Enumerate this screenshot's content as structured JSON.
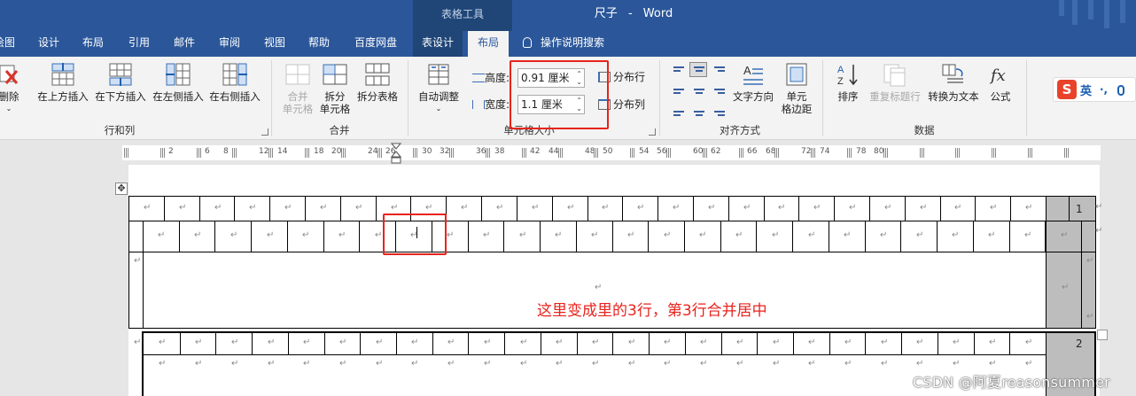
{
  "window": {
    "context_tab_group": "表格工具",
    "doc_name": "尺子",
    "separator": "-",
    "app_name": "Word"
  },
  "tabs": [
    {
      "label": "绘图"
    },
    {
      "label": "设计"
    },
    {
      "label": "布局"
    },
    {
      "label": "引用"
    },
    {
      "label": "邮件"
    },
    {
      "label": "审阅"
    },
    {
      "label": "视图"
    },
    {
      "label": "帮助"
    },
    {
      "label": "百度网盘"
    },
    {
      "label": "表设计"
    },
    {
      "label": "布局",
      "active": true
    }
  ],
  "search": {
    "label": "操作说明搜索"
  },
  "ribbon": {
    "delete": {
      "label": "删除"
    },
    "insert_above": {
      "label": "在上方插入"
    },
    "insert_below": {
      "label": "在下方插入"
    },
    "insert_left": {
      "label": "在左侧插入"
    },
    "insert_right": {
      "label": "在右侧插入"
    },
    "group_rows_cols": "行和列",
    "merge_cells": {
      "line1": "合并",
      "line2": "单元格"
    },
    "split_cells": {
      "line1": "拆分",
      "line2": "单元格"
    },
    "split_table": {
      "label": "拆分表格"
    },
    "group_merge": "合并",
    "autofit": {
      "label": "自动调整"
    },
    "height_label": "高度:",
    "height_value": "0.91 厘米",
    "width_label": "宽度:",
    "width_value": "1.1 厘米",
    "distribute_rows": "分布行",
    "distribute_cols": "分布列",
    "group_cell_size": "单元格大小",
    "text_direction": {
      "label": "文字方向"
    },
    "cell_margins": {
      "line1": "单元",
      "line2": "格边距"
    },
    "group_alignment": "对齐方式",
    "sort": {
      "label": "排序"
    },
    "repeat_header": {
      "label": "重复标题行"
    },
    "convert_to_text": {
      "label": "转换为文本"
    },
    "formula": {
      "label": "公式"
    },
    "group_data": "数据"
  },
  "ime": {
    "logo": "S",
    "mode": "英"
  },
  "ruler": {
    "labels": [
      "2",
      "6",
      "8",
      "12",
      "14",
      "18",
      "20",
      "24",
      "26",
      "30",
      "32",
      "36",
      "38",
      "42",
      "44",
      "48",
      "50",
      "54",
      "56",
      "60",
      "62",
      "66",
      "68",
      "72",
      "74",
      "78",
      "80"
    ]
  },
  "document": {
    "paragraph_mark": "↵",
    "page1_number": "1",
    "page2_number": "2",
    "annotation": "这里变成里的3行，第3行合并居中",
    "move_handle": "✥"
  },
  "watermark": "CSDN @阿夏reasonsummer",
  "colors": {
    "title_bar": "#2b579a",
    "context_tab": "#1f4677",
    "ribbon": "#f3f3f3",
    "annotation_red": "#e8231d"
  }
}
